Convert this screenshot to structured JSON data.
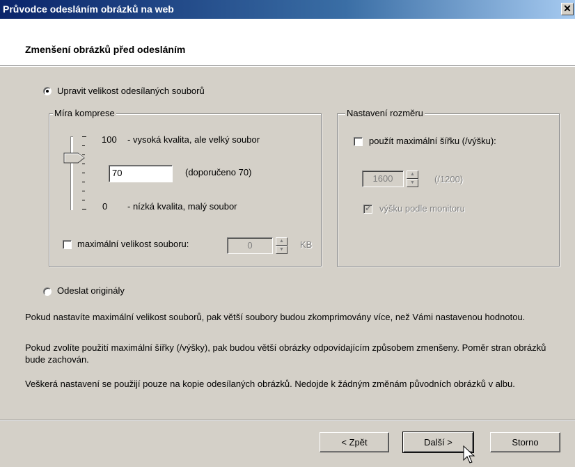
{
  "window": {
    "title": "Průvodce odesláním obrázků na web",
    "close_glyph": "✕"
  },
  "header": {
    "title": "Zmenšení obrázků před odesláním"
  },
  "options": {
    "resize_label": "Upravit velikost odesílaných souborů",
    "resize_selected": true,
    "original_label": "Odeslat originály",
    "original_selected": false
  },
  "compression": {
    "legend": "Míra komprese",
    "high_value": "100",
    "high_desc": "- vysoká kvalita, ale velký soubor",
    "input_value": "70",
    "recommended": "(doporučeno 70)",
    "low_value": "0",
    "low_desc": "- nízká kvalita, malý soubor",
    "slider_level_percent": 70,
    "max_size_label": "maximální velikost souboru:",
    "max_size_value": "0",
    "max_size_unit": "KB",
    "max_size_checked": false
  },
  "dimensions": {
    "legend": "Nastavení rozměru",
    "max_width_label": "použít maximální šířku (/výšku):",
    "max_width_checked": false,
    "width_value": "1600",
    "height_value": "(/1200)",
    "monitor_label": "výšku podle monitoru",
    "monitor_checked": true
  },
  "info": {
    "p1": "Pokud nastavíte maximální velikost souborů, pak větší soubory budou zkomprimovány více, než Vámi nastavenou hodnotou.",
    "p2": "Pokud zvolíte použití maximální šířky (/výšky), pak budou větší obrázky odpovídajícím způsobem zmenšeny. Poměr stran obrázků bude zachován.",
    "p3": "Veškerá nastavení se použijí pouze na kopie odesílaných obrázků. Nedojde k žádným změnám původních obrázků v albu."
  },
  "buttons": {
    "back": "< Zpět",
    "next": "Další >",
    "cancel": "Storno"
  }
}
